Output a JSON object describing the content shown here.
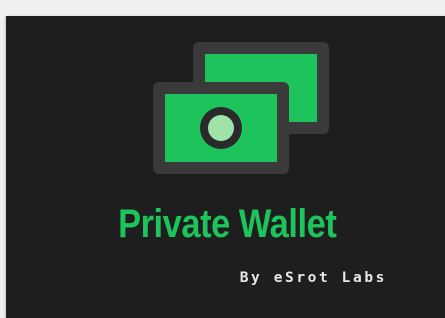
{
  "brand": {
    "title": "Private Wallet",
    "subtitle": "By eSrot Labs",
    "logo_icon": "banknotes-icon"
  },
  "colors": {
    "background": "#1e1e1e",
    "accent_green": "#1dc35b",
    "frame_gray": "#3a3a3a",
    "coin_light": "#9fe3a8",
    "text_light": "#e8e8e8"
  }
}
